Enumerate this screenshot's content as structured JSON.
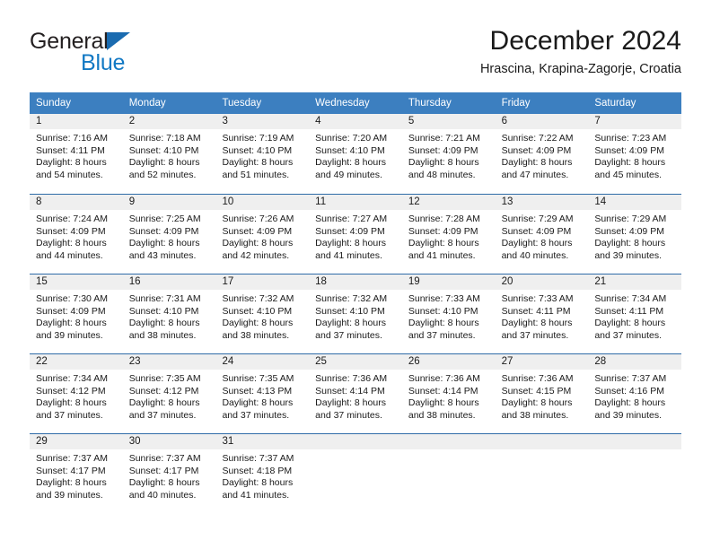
{
  "logo": {
    "word1": "General",
    "word2": "Blue",
    "triangle_color": "#1a6bb0",
    "word1_color": "#231f20",
    "word2_color": "#1279c4"
  },
  "header": {
    "title": "December 2024",
    "subtitle": "Hrascina, Krapina-Zagorje, Croatia"
  },
  "theme": {
    "header_bg": "#3c7fc0",
    "header_text": "#ffffff",
    "row_divider": "#2f6ca8",
    "day_band_bg": "#efefef",
    "body_text": "#1a1a1a"
  },
  "weekdays": [
    "Sunday",
    "Monday",
    "Tuesday",
    "Wednesday",
    "Thursday",
    "Friday",
    "Saturday"
  ],
  "weeks": [
    [
      {
        "day": "1",
        "sunrise": "Sunrise: 7:16 AM",
        "sunset": "Sunset: 4:11 PM",
        "daylight": "Daylight: 8 hours and 54 minutes."
      },
      {
        "day": "2",
        "sunrise": "Sunrise: 7:18 AM",
        "sunset": "Sunset: 4:10 PM",
        "daylight": "Daylight: 8 hours and 52 minutes."
      },
      {
        "day": "3",
        "sunrise": "Sunrise: 7:19 AM",
        "sunset": "Sunset: 4:10 PM",
        "daylight": "Daylight: 8 hours and 51 minutes."
      },
      {
        "day": "4",
        "sunrise": "Sunrise: 7:20 AM",
        "sunset": "Sunset: 4:10 PM",
        "daylight": "Daylight: 8 hours and 49 minutes."
      },
      {
        "day": "5",
        "sunrise": "Sunrise: 7:21 AM",
        "sunset": "Sunset: 4:09 PM",
        "daylight": "Daylight: 8 hours and 48 minutes."
      },
      {
        "day": "6",
        "sunrise": "Sunrise: 7:22 AM",
        "sunset": "Sunset: 4:09 PM",
        "daylight": "Daylight: 8 hours and 47 minutes."
      },
      {
        "day": "7",
        "sunrise": "Sunrise: 7:23 AM",
        "sunset": "Sunset: 4:09 PM",
        "daylight": "Daylight: 8 hours and 45 minutes."
      }
    ],
    [
      {
        "day": "8",
        "sunrise": "Sunrise: 7:24 AM",
        "sunset": "Sunset: 4:09 PM",
        "daylight": "Daylight: 8 hours and 44 minutes."
      },
      {
        "day": "9",
        "sunrise": "Sunrise: 7:25 AM",
        "sunset": "Sunset: 4:09 PM",
        "daylight": "Daylight: 8 hours and 43 minutes."
      },
      {
        "day": "10",
        "sunrise": "Sunrise: 7:26 AM",
        "sunset": "Sunset: 4:09 PM",
        "daylight": "Daylight: 8 hours and 42 minutes."
      },
      {
        "day": "11",
        "sunrise": "Sunrise: 7:27 AM",
        "sunset": "Sunset: 4:09 PM",
        "daylight": "Daylight: 8 hours and 41 minutes."
      },
      {
        "day": "12",
        "sunrise": "Sunrise: 7:28 AM",
        "sunset": "Sunset: 4:09 PM",
        "daylight": "Daylight: 8 hours and 41 minutes."
      },
      {
        "day": "13",
        "sunrise": "Sunrise: 7:29 AM",
        "sunset": "Sunset: 4:09 PM",
        "daylight": "Daylight: 8 hours and 40 minutes."
      },
      {
        "day": "14",
        "sunrise": "Sunrise: 7:29 AM",
        "sunset": "Sunset: 4:09 PM",
        "daylight": "Daylight: 8 hours and 39 minutes."
      }
    ],
    [
      {
        "day": "15",
        "sunrise": "Sunrise: 7:30 AM",
        "sunset": "Sunset: 4:09 PM",
        "daylight": "Daylight: 8 hours and 39 minutes."
      },
      {
        "day": "16",
        "sunrise": "Sunrise: 7:31 AM",
        "sunset": "Sunset: 4:10 PM",
        "daylight": "Daylight: 8 hours and 38 minutes."
      },
      {
        "day": "17",
        "sunrise": "Sunrise: 7:32 AM",
        "sunset": "Sunset: 4:10 PM",
        "daylight": "Daylight: 8 hours and 38 minutes."
      },
      {
        "day": "18",
        "sunrise": "Sunrise: 7:32 AM",
        "sunset": "Sunset: 4:10 PM",
        "daylight": "Daylight: 8 hours and 37 minutes."
      },
      {
        "day": "19",
        "sunrise": "Sunrise: 7:33 AM",
        "sunset": "Sunset: 4:10 PM",
        "daylight": "Daylight: 8 hours and 37 minutes."
      },
      {
        "day": "20",
        "sunrise": "Sunrise: 7:33 AM",
        "sunset": "Sunset: 4:11 PM",
        "daylight": "Daylight: 8 hours and 37 minutes."
      },
      {
        "day": "21",
        "sunrise": "Sunrise: 7:34 AM",
        "sunset": "Sunset: 4:11 PM",
        "daylight": "Daylight: 8 hours and 37 minutes."
      }
    ],
    [
      {
        "day": "22",
        "sunrise": "Sunrise: 7:34 AM",
        "sunset": "Sunset: 4:12 PM",
        "daylight": "Daylight: 8 hours and 37 minutes."
      },
      {
        "day": "23",
        "sunrise": "Sunrise: 7:35 AM",
        "sunset": "Sunset: 4:12 PM",
        "daylight": "Daylight: 8 hours and 37 minutes."
      },
      {
        "day": "24",
        "sunrise": "Sunrise: 7:35 AM",
        "sunset": "Sunset: 4:13 PM",
        "daylight": "Daylight: 8 hours and 37 minutes."
      },
      {
        "day": "25",
        "sunrise": "Sunrise: 7:36 AM",
        "sunset": "Sunset: 4:14 PM",
        "daylight": "Daylight: 8 hours and 37 minutes."
      },
      {
        "day": "26",
        "sunrise": "Sunrise: 7:36 AM",
        "sunset": "Sunset: 4:14 PM",
        "daylight": "Daylight: 8 hours and 38 minutes."
      },
      {
        "day": "27",
        "sunrise": "Sunrise: 7:36 AM",
        "sunset": "Sunset: 4:15 PM",
        "daylight": "Daylight: 8 hours and 38 minutes."
      },
      {
        "day": "28",
        "sunrise": "Sunrise: 7:37 AM",
        "sunset": "Sunset: 4:16 PM",
        "daylight": "Daylight: 8 hours and 39 minutes."
      }
    ],
    [
      {
        "day": "29",
        "sunrise": "Sunrise: 7:37 AM",
        "sunset": "Sunset: 4:17 PM",
        "daylight": "Daylight: 8 hours and 39 minutes."
      },
      {
        "day": "30",
        "sunrise": "Sunrise: 7:37 AM",
        "sunset": "Sunset: 4:17 PM",
        "daylight": "Daylight: 8 hours and 40 minutes."
      },
      {
        "day": "31",
        "sunrise": "Sunrise: 7:37 AM",
        "sunset": "Sunset: 4:18 PM",
        "daylight": "Daylight: 8 hours and 41 minutes."
      },
      {
        "day": "",
        "sunrise": "",
        "sunset": "",
        "daylight": ""
      },
      {
        "day": "",
        "sunrise": "",
        "sunset": "",
        "daylight": ""
      },
      {
        "day": "",
        "sunrise": "",
        "sunset": "",
        "daylight": ""
      },
      {
        "day": "",
        "sunrise": "",
        "sunset": "",
        "daylight": ""
      }
    ]
  ]
}
